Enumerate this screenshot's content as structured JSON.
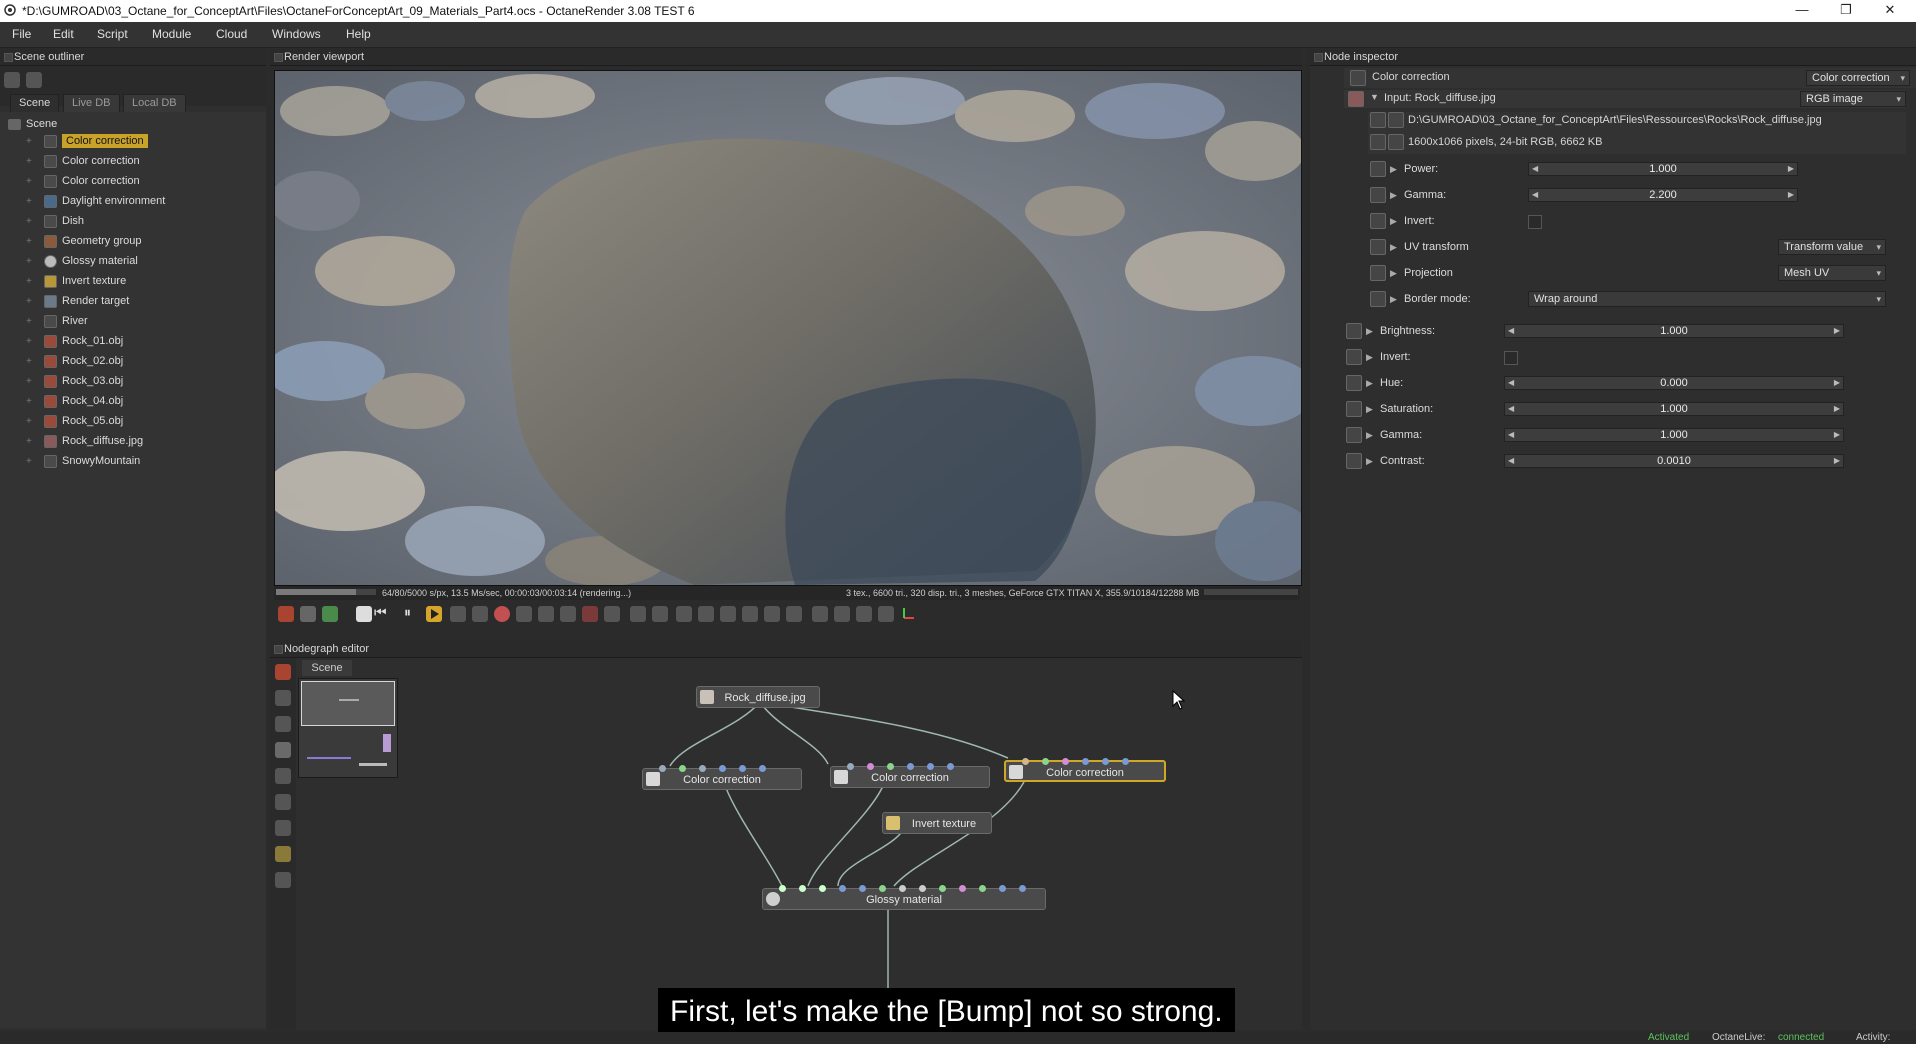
{
  "titlebar": {
    "title": "*D:\\GUMROAD\\03_Octane_for_ConceptArt\\Files\\OctaneForConceptArt_09_Materials_Part4.ocs - OctaneRender 3.08 TEST 6",
    "minimize": "—",
    "restore": "❐",
    "close": "✕"
  },
  "menu": [
    "File",
    "Edit",
    "Script",
    "Module",
    "Cloud",
    "Windows",
    "Help"
  ],
  "outliner": {
    "header": "Scene outliner",
    "tabs": [
      "Scene",
      "Live DB",
      "Local DB"
    ],
    "root": "Scene",
    "items": [
      {
        "label": "Color correction",
        "icon": "color-correction-icon"
      },
      {
        "label": "Color correction",
        "icon": "color-correction-icon"
      },
      {
        "label": "Color correction",
        "icon": "color-correction-icon"
      },
      {
        "label": "Daylight environment",
        "icon": "environment-icon"
      },
      {
        "label": "Dish",
        "icon": "geometry-icon"
      },
      {
        "label": "Geometry group",
        "icon": "geometry-group-icon"
      },
      {
        "label": "Glossy material",
        "icon": "material-sphere-icon"
      },
      {
        "label": "Invert texture",
        "icon": "texture-icon"
      },
      {
        "label": "Render target",
        "icon": "render-target-icon"
      },
      {
        "label": "River",
        "icon": "geometry-icon"
      },
      {
        "label": "Rock_01.obj",
        "icon": "mesh-icon"
      },
      {
        "label": "Rock_02.obj",
        "icon": "mesh-icon"
      },
      {
        "label": "Rock_03.obj",
        "icon": "mesh-icon"
      },
      {
        "label": "Rock_04.obj",
        "icon": "mesh-icon"
      },
      {
        "label": "Rock_05.obj",
        "icon": "mesh-icon"
      },
      {
        "label": "Rock_diffuse.jpg",
        "icon": "image-icon"
      },
      {
        "label": "SnowyMountain",
        "icon": "geometry-icon"
      }
    ]
  },
  "viewport": {
    "header": "Render viewport",
    "status_left": "64/80/5000 s/px, 13.5 Ms/sec, 00:00:03/00:03:14 (rendering...)",
    "status_right": "3 tex., 6600 tri., 320 disp. tri., 3 meshes, GeForce GTX TITAN X, 355.9/10184/12288 MB",
    "progress": 0.8
  },
  "nodegraph": {
    "header": "Nodegraph editor",
    "tab": "Scene",
    "nodes": {
      "rock_diffuse": "Rock_diffuse.jpg",
      "cc1": "Color correction",
      "cc2": "Color correction",
      "cc3": "Color correction",
      "invert": "Invert texture",
      "glossy": "Glossy material"
    }
  },
  "inspector": {
    "header": "Node inspector",
    "node_name": "Color correction",
    "node_type": "Color correction",
    "input_label": "Input: Rock_diffuse.jpg",
    "input_type": "RGB image",
    "file_path": "D:\\GUMROAD\\03_Octane_for_ConceptArt\\Files\\Ressources\\Rocks\\Rock_diffuse.jpg",
    "file_info": "1600x1066 pixels, 24-bit RGB, 6662 KB",
    "inner": {
      "power_label": "Power:",
      "power_value": "1.000",
      "gamma_label": "Gamma:",
      "gamma_value": "2.200",
      "invert_label": "Invert:",
      "uv_label": "UV transform",
      "uv_value": "Transform value",
      "projection_label": "Projection",
      "projection_value": "Mesh UV",
      "border_label": "Border mode:",
      "border_value": "Wrap around"
    },
    "outer": {
      "brightness_label": "Brightness:",
      "brightness_value": "1.000",
      "invert_label": "Invert:",
      "hue_label": "Hue:",
      "hue_value": "0.000",
      "saturation_label": "Saturation:",
      "saturation_value": "1.000",
      "gamma_label": "Gamma:",
      "gamma_value": "1.000",
      "contrast_label": "Contrast:",
      "contrast_value": "0.0010"
    }
  },
  "subtitle": "First, let's make the [Bump] not so strong.",
  "statusbar": {
    "activated": "Activated",
    "live_label": "OctaneLive:",
    "live_value": "connected",
    "activity": "Activity:"
  },
  "colors": {
    "accent": "#c9a22a",
    "status_green": "#5bc25b"
  }
}
